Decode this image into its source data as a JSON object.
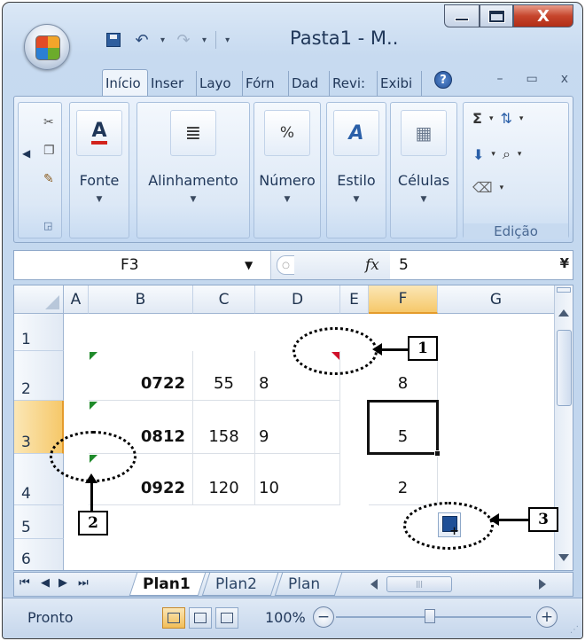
{
  "window": {
    "title": "Pasta1 - M..",
    "close_glyph": "X"
  },
  "quick_access": {
    "items": [
      "save-icon",
      "undo-icon",
      "redo-icon",
      "customize-icon"
    ]
  },
  "ribbon": {
    "tabs": [
      {
        "label": "Início",
        "active": true
      },
      {
        "label": "Inser",
        "active": false
      },
      {
        "label": "Layo",
        "active": false
      },
      {
        "label": "Fórn",
        "active": false
      },
      {
        "label": "Dad",
        "active": false
      },
      {
        "label": "Revi:",
        "active": false
      },
      {
        "label": "Exibi",
        "active": false
      }
    ],
    "groups": {
      "fonte": "Fonte",
      "alinhamento": "Alinhamento",
      "numero": "Número",
      "estilo": "Estilo",
      "celulas": "Células",
      "edicao": "Edição"
    },
    "numero_icon_glyph": "%"
  },
  "formula_bar": {
    "name_box": "F3",
    "fx": "fx",
    "value": "5"
  },
  "sheet": {
    "columns": [
      "A",
      "B",
      "C",
      "D",
      "E",
      "F",
      "G"
    ],
    "rows": [
      "1",
      "2",
      "3",
      "4",
      "5",
      "6"
    ],
    "selected_column": "F",
    "selected_row": "3",
    "cells": {
      "B2": "0722",
      "C2": "55",
      "D2": "8",
      "F2": "8",
      "B3": "0812",
      "C3": "158",
      "D3": "9",
      "F3": "5",
      "B4": "0922",
      "C4": "120",
      "D4": "10",
      "F4": "2"
    }
  },
  "sheet_tabs": [
    "Plan1",
    "Plan2",
    "Plan"
  ],
  "active_sheet": "Plan1",
  "status": {
    "text": "Pronto",
    "zoom": "100%"
  },
  "callouts": [
    "1",
    "2",
    "3"
  ],
  "colors": {
    "selection_header": "#f6c86a",
    "error_green": "#1f8a2a",
    "comment_red": "#d0102a",
    "close_red": "#c6452c"
  }
}
